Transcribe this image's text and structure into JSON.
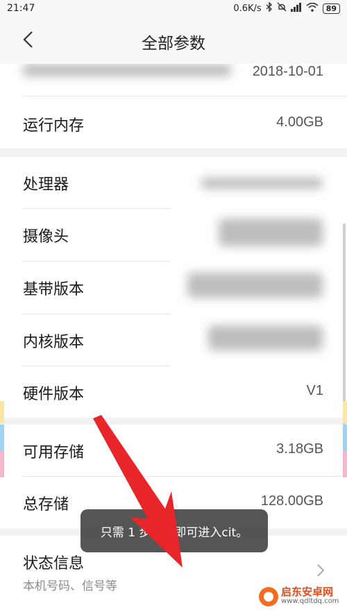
{
  "status_bar": {
    "time": "21:47",
    "network_speed": "0.6K/s",
    "battery": "89"
  },
  "header": {
    "title": "全部参数"
  },
  "rows": {
    "android_patch": {
      "value": "2018-10-01"
    },
    "ram": {
      "label": "运行内存",
      "value": "4.00GB"
    },
    "processor": {
      "label": "处理器"
    },
    "camera": {
      "label": "摄像头"
    },
    "baseband": {
      "label": "基带版本"
    },
    "kernel": {
      "label": "内核版本"
    },
    "hardware": {
      "label": "硬件版本",
      "value": "V1"
    },
    "available_storage": {
      "label": "可用存储",
      "value": "3.18GB"
    },
    "total_storage": {
      "label": "总存储",
      "value": "128.00GB"
    },
    "status_info": {
      "label": "状态信息",
      "sublabel": "本机号码、信号等"
    }
  },
  "toast": {
    "text": "只需 1 步操作即可进入cit。"
  },
  "watermark": {
    "name": "启东安卓网",
    "url": "www.qdltdq.com"
  },
  "colors": {
    "arrow": "#e8262a",
    "toast_bg": "#484848"
  }
}
